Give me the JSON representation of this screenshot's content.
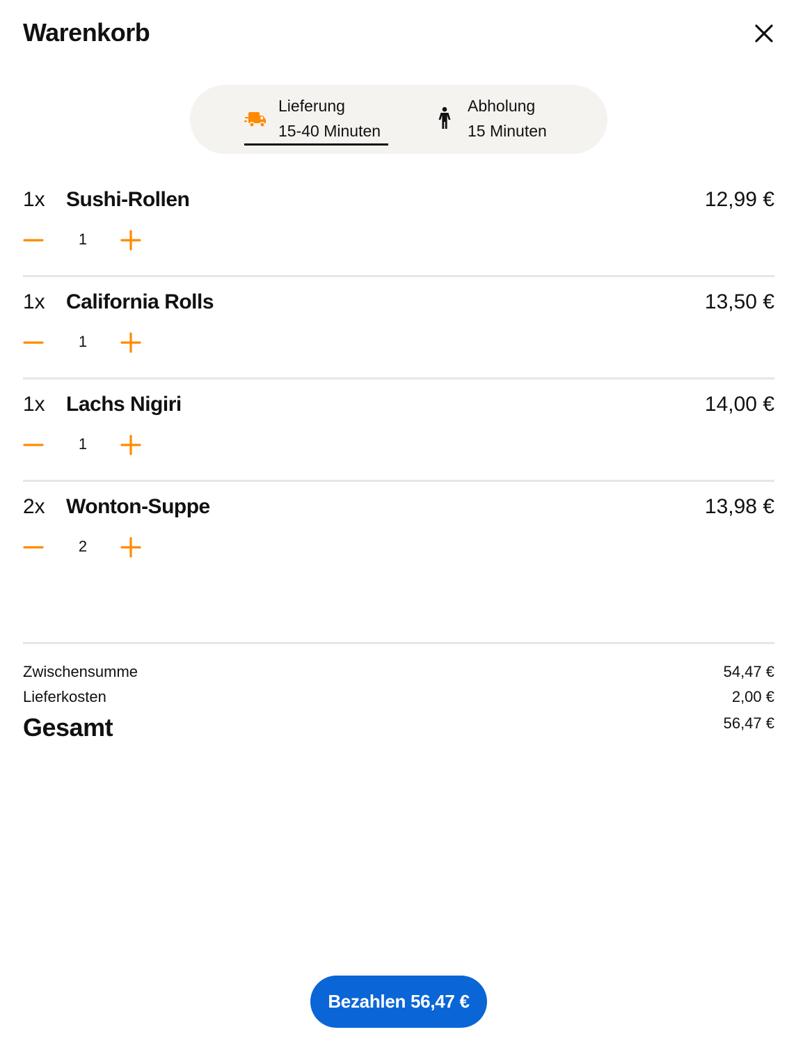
{
  "header": {
    "title": "Warenkorb",
    "close_icon": "close-icon"
  },
  "fulfillment": {
    "delivery": {
      "label": "Lieferung",
      "time": "15-40 Minuten",
      "icon": "delivery-truck-icon",
      "selected": true
    },
    "pickup": {
      "label": "Abholung",
      "time": "15 Minuten",
      "icon": "person-walking-icon",
      "selected": false
    }
  },
  "items": [
    {
      "qty_prefix": "1x",
      "name": "Sushi-Rollen",
      "price": "12,99 €",
      "count": "1"
    },
    {
      "qty_prefix": "1x",
      "name": "California Rolls",
      "price": "13,50 €",
      "count": "1"
    },
    {
      "qty_prefix": "1x",
      "name": "Lachs Nigiri",
      "price": "14,00 €",
      "count": "1"
    },
    {
      "qty_prefix": "2x",
      "name": "Wonton-Suppe",
      "price": "13,98 €",
      "count": "2"
    }
  ],
  "summary": {
    "subtotal_label": "Zwischensumme",
    "subtotal_value": "54,47 €",
    "delivery_label": "Lieferkosten",
    "delivery_value": "2,00 €",
    "total_label": "Gesamt",
    "total_value": "56,47 €"
  },
  "checkout": {
    "pay_label": "Bezahlen 56,47 €"
  },
  "colors": {
    "accent": "#ff8a00",
    "primary_button": "#0a66d6",
    "switcher_bg": "#f5f3ef",
    "divider": "#e6e6e6"
  }
}
